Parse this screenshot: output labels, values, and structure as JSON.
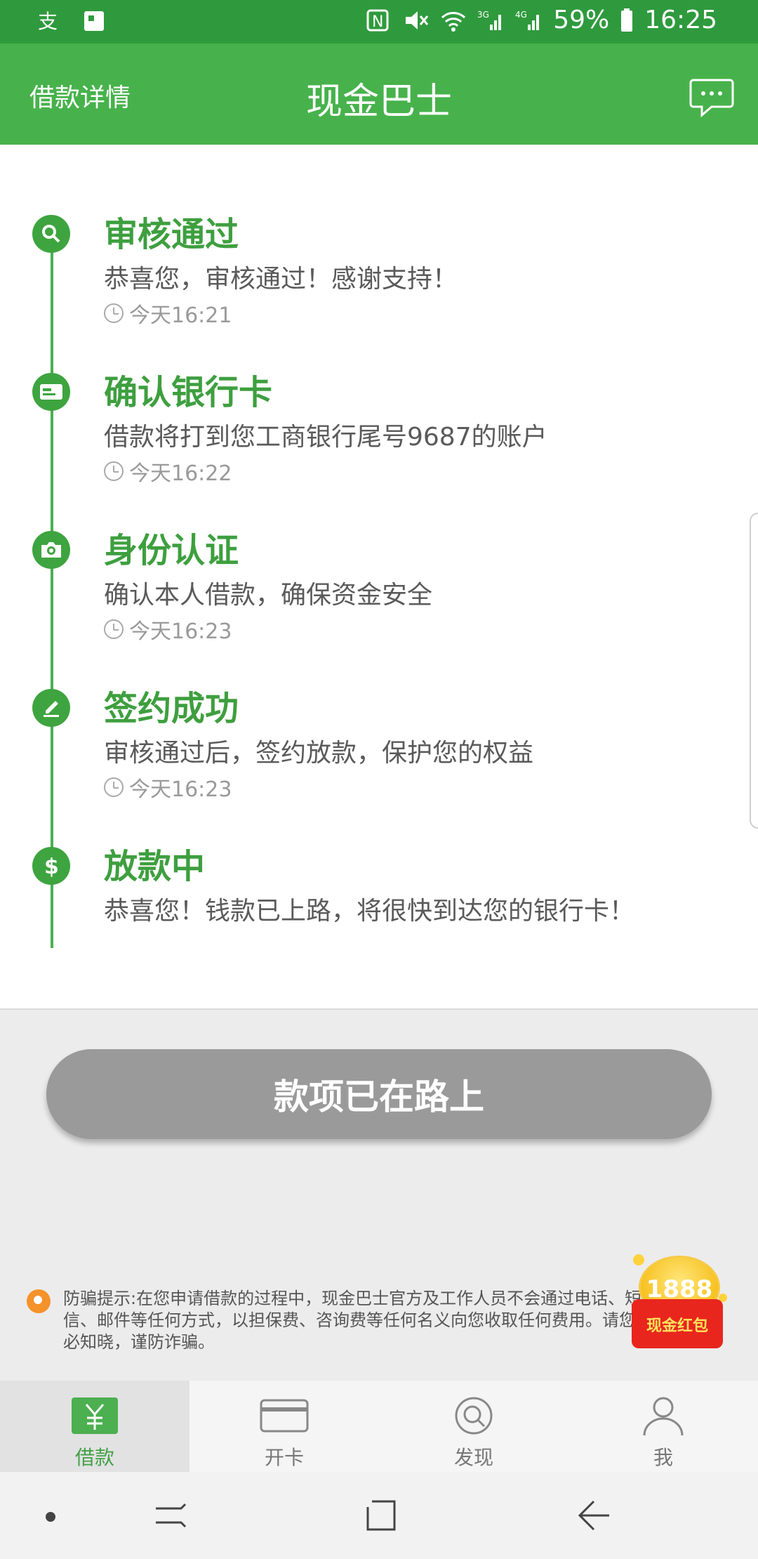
{
  "status_bar": {
    "battery": "59%",
    "time": "16:25",
    "icons": [
      "alipay-icon",
      "sim-icon",
      "nfc-icon",
      "mute-icon",
      "wifi-icon",
      "signal-3g-icon",
      "signal-4g-icon",
      "battery-icon"
    ]
  },
  "header": {
    "left_label": "借款详情",
    "title": "现金巴士",
    "right_icon": "chat-icon"
  },
  "steps": [
    {
      "icon": "search-icon",
      "title": "审核通过",
      "desc": "恭喜您，审核通过！感谢支持！",
      "time": "今天16:21"
    },
    {
      "icon": "bank-card-icon",
      "title": "确认银行卡",
      "desc": "借款将打到您工商银行尾号9687的账户",
      "time": "今天16:22"
    },
    {
      "icon": "camera-icon",
      "title": "身份认证",
      "desc": "确认本人借款，确保资金安全",
      "time": "今天16:23"
    },
    {
      "icon": "sign-icon",
      "title": "签约成功",
      "desc": "审核通过后，签约放款，保护您的权益",
      "time": "今天16:23"
    },
    {
      "icon": "dollar-icon",
      "title": "放款中",
      "desc": "恭喜您！钱款已上路，将很快到达您的银行卡！",
      "time": ""
    }
  ],
  "main_button": {
    "label": "款项已在路上"
  },
  "notice": {
    "text": "防骗提示:在您申请借款的过程中，现金巴士官方及工作人员不会通过电话、短信、邮件等任何方式，以担保费、咨询费等任何名义向您收取任何费用。请您务必知晓，谨防诈骗。"
  },
  "redpack": {
    "amount": "1888",
    "label": "现金红包"
  },
  "tabs": [
    {
      "label": "借款",
      "icon": "loan-yuan-icon",
      "active": true
    },
    {
      "label": "开卡",
      "icon": "card-icon",
      "active": false
    },
    {
      "label": "发现",
      "icon": "discover-icon",
      "active": false
    },
    {
      "label": "我",
      "icon": "profile-icon",
      "active": false
    }
  ],
  "colors": {
    "accent": "#47b24b",
    "status_bar": "#2f9a3d",
    "button_disabled": "#9a9a9a"
  }
}
